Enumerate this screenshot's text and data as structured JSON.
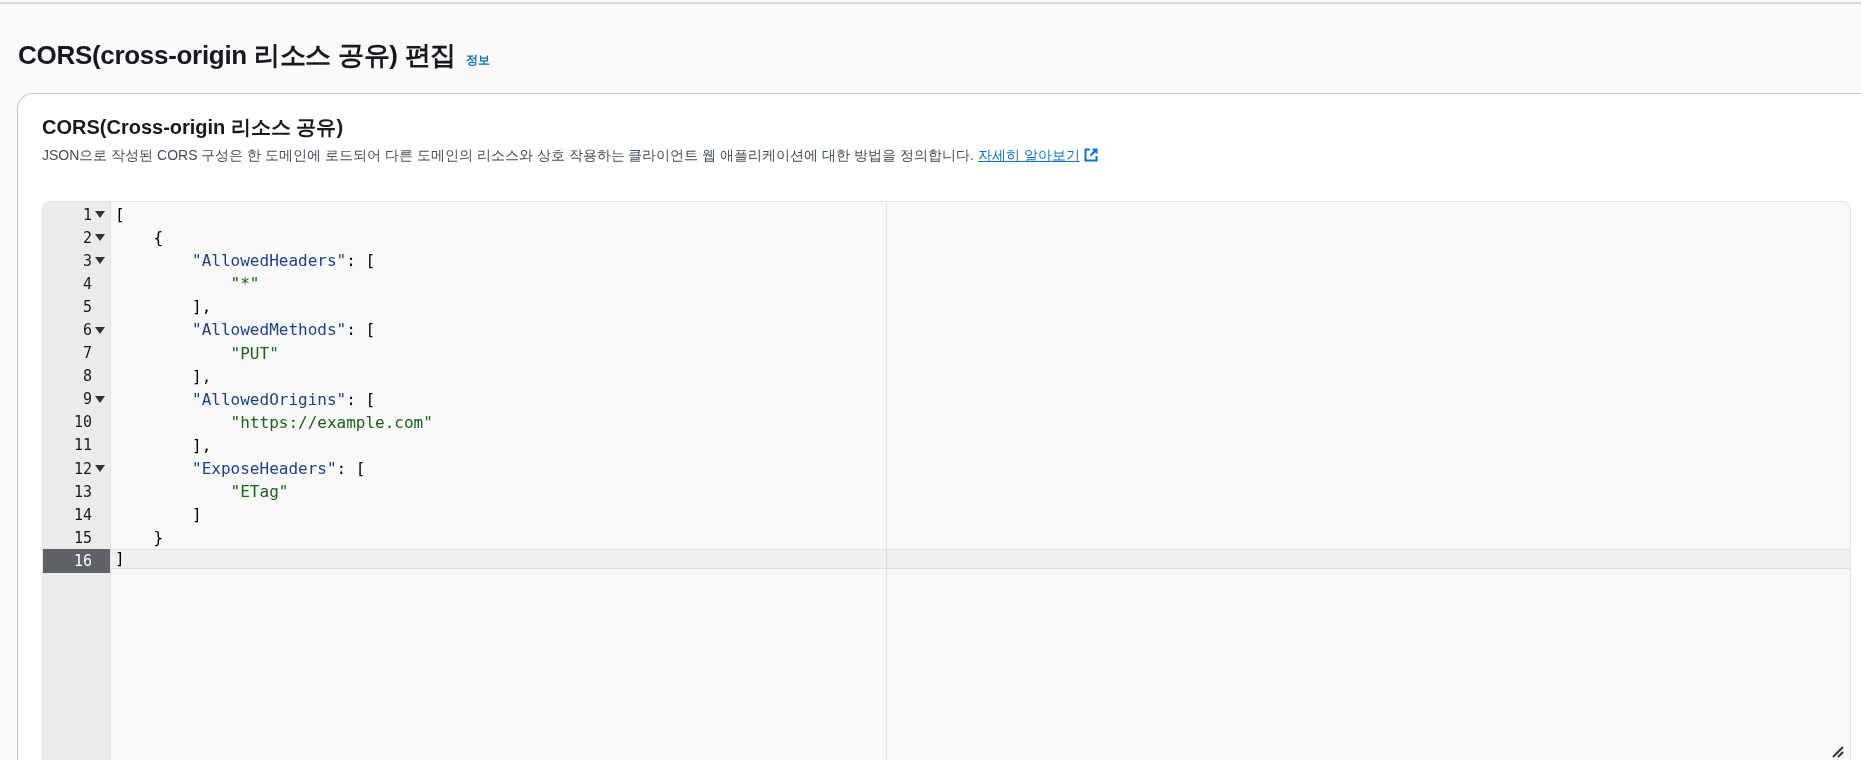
{
  "page_title": "CORS(cross-origin 리소스 공유) 편집",
  "info_link": "정보",
  "panel": {
    "title": "CORS(Cross-origin 리소스 공유)",
    "description": "JSON으로 작성된 CORS 구성은 한 도메인에 로드되어 다른 도메인의 리소스와 상호 작용하는 클라이언트 웹 애플리케이션에 대한 방법을 정의합니다.",
    "learn_more_link": "자세히 알아보기"
  },
  "editor": {
    "lines": [
      {
        "number": "1",
        "foldable": true,
        "active": false,
        "tokens": [
          {
            "kind": "punct",
            "text": "["
          }
        ]
      },
      {
        "number": "2",
        "foldable": true,
        "active": false,
        "tokens": [
          {
            "kind": "punct",
            "text": "{"
          }
        ]
      },
      {
        "number": "3",
        "foldable": true,
        "active": false,
        "tokens": [
          {
            "kind": "key",
            "text": "\"AllowedHeaders\""
          },
          {
            "kind": "punct",
            "text": ": ["
          }
        ]
      },
      {
        "number": "4",
        "foldable": false,
        "active": false,
        "tokens": [
          {
            "kind": "string",
            "text": "\"*\""
          }
        ]
      },
      {
        "number": "5",
        "foldable": false,
        "active": false,
        "tokens": [
          {
            "kind": "punct",
            "text": "],"
          }
        ]
      },
      {
        "number": "6",
        "foldable": true,
        "active": false,
        "tokens": [
          {
            "kind": "key",
            "text": "\"AllowedMethods\""
          },
          {
            "kind": "punct",
            "text": ": ["
          }
        ]
      },
      {
        "number": "7",
        "foldable": false,
        "active": false,
        "tokens": [
          {
            "kind": "string",
            "text": "\"PUT\""
          }
        ]
      },
      {
        "number": "8",
        "foldable": false,
        "active": false,
        "tokens": [
          {
            "kind": "punct",
            "text": "],"
          }
        ]
      },
      {
        "number": "9",
        "foldable": true,
        "active": false,
        "tokens": [
          {
            "kind": "key",
            "text": "\"AllowedOrigins\""
          },
          {
            "kind": "punct",
            "text": ": ["
          }
        ]
      },
      {
        "number": "10",
        "foldable": false,
        "active": false,
        "tokens": [
          {
            "kind": "string",
            "text": "\"https://example.com\""
          }
        ]
      },
      {
        "number": "11",
        "foldable": false,
        "active": false,
        "tokens": [
          {
            "kind": "punct",
            "text": "],"
          }
        ]
      },
      {
        "number": "12",
        "foldable": true,
        "active": false,
        "tokens": [
          {
            "kind": "key",
            "text": "\"ExposeHeaders\""
          },
          {
            "kind": "punct",
            "text": ": ["
          }
        ]
      },
      {
        "number": "13",
        "foldable": false,
        "active": false,
        "tokens": [
          {
            "kind": "string",
            "text": "\"ETag\""
          }
        ]
      },
      {
        "number": "14",
        "foldable": false,
        "active": false,
        "tokens": [
          {
            "kind": "punct",
            "text": "]"
          }
        ]
      },
      {
        "number": "15",
        "foldable": false,
        "active": false,
        "tokens": [
          {
            "kind": "punct",
            "text": "}"
          }
        ]
      },
      {
        "number": "16",
        "foldable": false,
        "active": true,
        "tokens": [
          {
            "kind": "punct",
            "text": "]"
          }
        ]
      }
    ]
  }
}
